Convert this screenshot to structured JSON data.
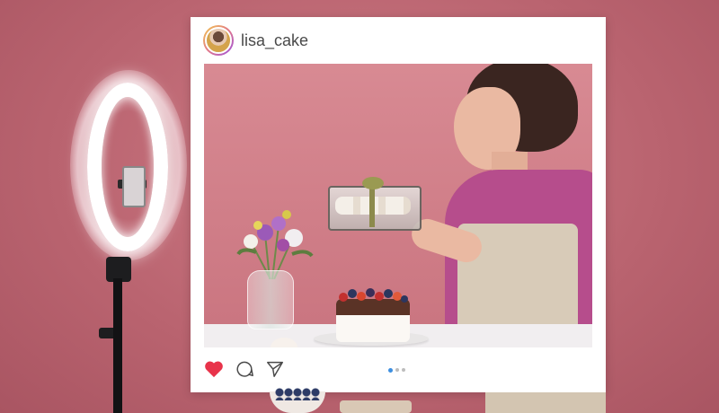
{
  "post": {
    "username": "lisa_cake",
    "avatar_icon": "profile-avatar",
    "carousel": {
      "count": 3,
      "active_index": 0
    }
  },
  "actions": {
    "like_icon": "heart-icon",
    "comment_icon": "comment-icon",
    "share_icon": "send-icon"
  },
  "colors": {
    "background": "#c46f7b",
    "like": "#e8334a",
    "active_dot": "#3d8fe0"
  }
}
